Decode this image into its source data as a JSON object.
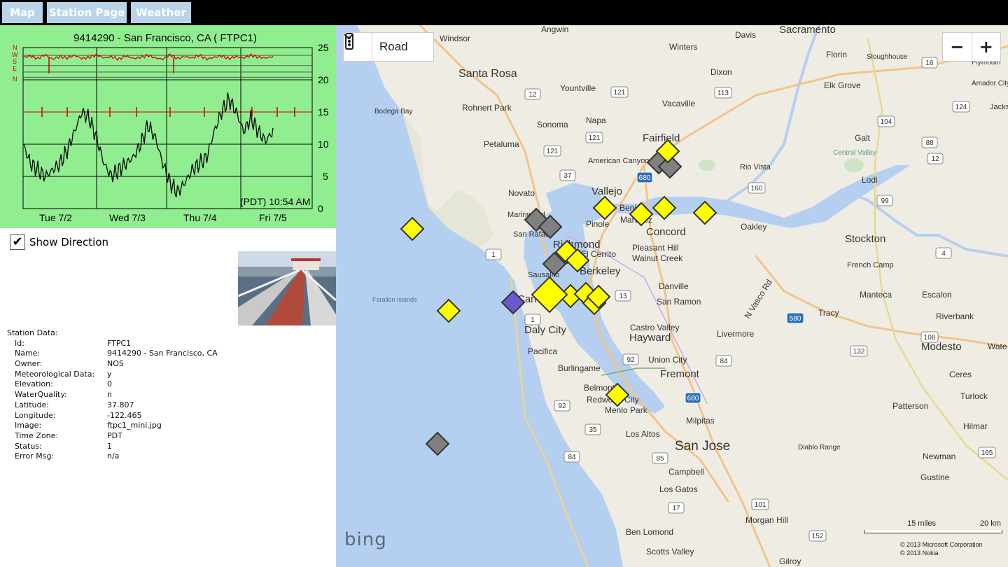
{
  "nav": {
    "map": "Map",
    "station_page": "Station Page",
    "weather": "Weather"
  },
  "chart_data": {
    "type": "line",
    "title": "9414290 - San Francisco, CA ( FTPC1)",
    "timestamp": "(PDT) 10:54 AM",
    "ylim": [
      0,
      25
    ],
    "y_ticks": [
      "25",
      "20",
      "15",
      "10",
      "5",
      "0"
    ],
    "x_ticks": [
      "Tue  7/2",
      "Wed  7/3",
      "Thu  7/4",
      "Fri  7/5"
    ],
    "direction_labels": [
      "N",
      "W",
      "S",
      "E",
      "N"
    ],
    "grid": true,
    "series": [
      {
        "color": "#000000",
        "values": [
          10,
          7,
          6,
          5,
          6,
          7,
          9,
          12,
          15,
          14,
          11,
          7,
          5,
          6,
          7,
          8,
          10,
          13,
          11,
          7,
          4,
          2.5,
          4,
          6,
          7,
          8,
          12,
          15,
          17,
          15,
          12,
          14,
          12,
          10.5,
          12
        ]
      },
      {
        "color": "#dd0000",
        "values": [
          23.5,
          23.7,
          23.3,
          23.9,
          23.2,
          23.6,
          23.4,
          23.8,
          23.3,
          23.5,
          23.9,
          23.4,
          23.6,
          23.2,
          23.7,
          23.3,
          23.5,
          23.8,
          23.4,
          23.2,
          23.9,
          23.3,
          23.6,
          23.4,
          23.8,
          23.2,
          23.5,
          23.7,
          23.3,
          23.6,
          23.4,
          23.8,
          23.5,
          23.4,
          23.6
        ]
      }
    ]
  },
  "show_direction": {
    "label": "Show Direction",
    "checked": true
  },
  "station": {
    "header": "Station Data:",
    "fields": [
      {
        "key": "Id:",
        "value": "FTPC1"
      },
      {
        "key": "Name:",
        "value": "9414290 - San Francisco, CA"
      },
      {
        "key": "Owner:",
        "value": "NOS"
      },
      {
        "key": "Meteorological Data:",
        "value": "y"
      },
      {
        "key": "Elevation:",
        "value": "0"
      },
      {
        "key": "WaterQuality:",
        "value": "n"
      },
      {
        "key": "Latitude:",
        "value": "37.807"
      },
      {
        "key": "Longitude:",
        "value": "-122.465"
      },
      {
        "key": "Image:",
        "value": "ftpc1_mini.jpg"
      },
      {
        "key": "Time Zone:",
        "value": "PDT"
      },
      {
        "key": "Status:",
        "value": "1"
      },
      {
        "key": "Error Msg:",
        "value": "n/a"
      }
    ]
  },
  "map": {
    "view_type": "Road",
    "zoom_out": "−",
    "zoom_in": "+",
    "logo": "bing",
    "scale_miles": "15 miles",
    "scale_km": "20 km",
    "copyright_1": "© 2013 Microsoft Corporation",
    "copyright_2": "© 2013 Nokia",
    "colors": {
      "water": "#b5cff0",
      "land": "#efece4",
      "active": "#ffff00",
      "inactive": "#808080",
      "selected": "#6a5acd"
    },
    "labels": {
      "sacramento": "Sacramento",
      "davis": "Davis",
      "windsor": "Windsor",
      "angwin": "Angwin",
      "winters": "Winters",
      "santa_rosa": "Santa Rosa",
      "florin": "Florin",
      "sloughhouse": "Sloughhouse",
      "dixon": "Dixon",
      "yountville": "Yountville",
      "rohnert_park": "Rohnert Park",
      "vacaville": "Vacaville",
      "elk_grove": "Elk Grove",
      "bodega_bay": "Bodega Bay",
      "sonoma": "Sonoma",
      "napa": "Napa",
      "fairfield": "Fairfield",
      "galt": "Galt",
      "petaluma": "Petaluma",
      "american_canyon": "American Canyon",
      "rio_vista": "Rio Vista",
      "central_valley": "Central Valley",
      "novato": "Novato",
      "vallejo": "Vallejo",
      "lodi": "Lodi",
      "marinwood": "Marinwood",
      "benicia": "Benicia",
      "pinole": "Pinole",
      "martinez": "Martinez",
      "concord": "Concord",
      "oakley": "Oakley",
      "san_rafael": "San Rafael",
      "richmond": "Richmond",
      "el_cerrito": "El Cerrito",
      "pleasant_hill": "Pleasant Hill",
      "walnut_creek": "Walnut Creek",
      "stockton": "Stockton",
      "sausalito": "Sausalito",
      "berkeley": "Berkeley",
      "french_camp": "French Camp",
      "farallon_islands": "Farallon Islands",
      "danville": "Danville",
      "n_vasco_rd": "N Vasco Rd",
      "san_ramon": "San Ramon",
      "manteca": "Manteca",
      "escalon": "Escalon",
      "tracy": "Tracy",
      "riverbank": "Riverbank",
      "daly_city": "Daly City",
      "castro_valley": "Castro Valley",
      "hayward": "Hayward",
      "livermore": "Livermore",
      "pacifica": "Pacifica",
      "modesto": "Modesto",
      "union_city": "Union City",
      "burlingame": "Burlingame",
      "fremont": "Fremont",
      "ceres": "Ceres",
      "belmont": "Belmont",
      "redwood_city": "Redwood City",
      "turlock": "Turlock",
      "menlo_park": "Menlo Park",
      "patterson": "Patterson",
      "milpitas": "Milpitas",
      "hilmar": "Hilmar",
      "los_altos": "Los Altos",
      "san_jose": "San Jose",
      "diablo_range": "Diablo Range",
      "newman": "Newman",
      "campbell": "Campbell",
      "gustine": "Gustine",
      "los_gatos": "Los Gatos",
      "morgan_hill": "Morgan Hill",
      "ben_lomond": "Ben Lomond",
      "scotts_valley": "Scotts Valley",
      "gilroy": "Gilroy",
      "plymouth": "Plymouth",
      "amador_city": "Amador City",
      "jackson": "Jacks",
      "waterford": "Wate",
      "can": "Can"
    },
    "shields": {
      "s12": "12",
      "s121a": "121",
      "s121b": "121",
      "s113": "113",
      "s16": "16",
      "s124": "124",
      "s104": "104",
      "s88": "88",
      "s12b": "12",
      "s37": "37",
      "s680a": "680",
      "s160": "160",
      "s99": "99",
      "s1": "1",
      "s4": "4",
      "s13": "13",
      "s580": "580",
      "s108": "108",
      "s132": "132",
      "s92": "92",
      "s84": "84",
      "s680b": "680",
      "s92b": "92",
      "s35": "35",
      "s165": "165",
      "s84b": "84",
      "s85": "85",
      "s17": "17",
      "s101": "101",
      "s152": "152"
    }
  }
}
